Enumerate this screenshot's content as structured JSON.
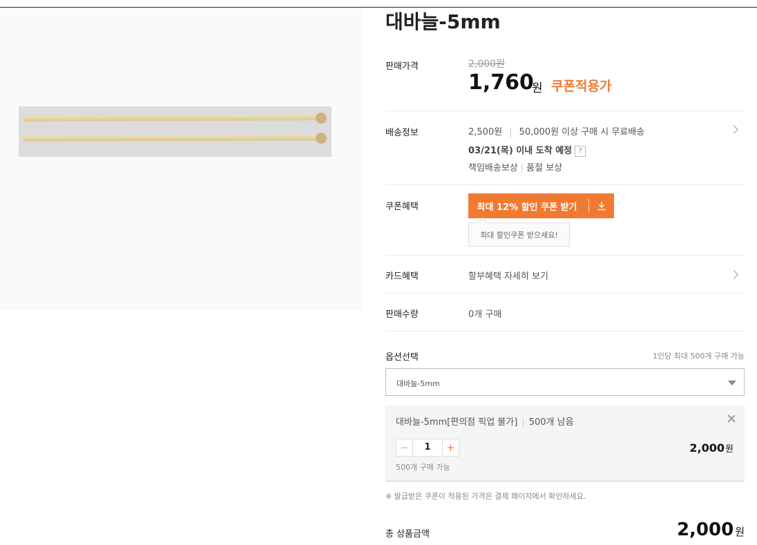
{
  "product": {
    "title": "대바늘-5mm"
  },
  "price": {
    "label": "판매가격",
    "original": "2,000원",
    "sale": "1,760",
    "sale_unit": "원",
    "coupon_applied": "쿠폰적용가"
  },
  "shipping": {
    "label": "배송정보",
    "fee": "2,500원",
    "free_condition": "50,000원 이상 구매 시 무료배송",
    "arrival": "03/21(목) 이내 도착 예정",
    "arrival_help_icon": "?",
    "guarantee_1": "책임배송보상",
    "guarantee_2": "품절 보상"
  },
  "coupon": {
    "label": "쿠폰혜택",
    "button_label": "최대 12% 할인 쿠폰 받기",
    "download_icon": "download-icon",
    "tooltip": "최대 할인쿠폰 받으세요!"
  },
  "card": {
    "label": "카드혜택",
    "text": "할부혜택 자세히 보기"
  },
  "sales": {
    "label": "판매수량",
    "text": "0개 구매"
  },
  "options": {
    "label": "옵션선택",
    "limit": "1인당 최대 500개 구매 가능",
    "selected": "대바늘-5mm",
    "item": {
      "name": "대바늘-5mm[편의점 픽업 불가]",
      "remaining": "500개 남음",
      "quantity": "1",
      "minus": "−",
      "plus": "+",
      "available": "500개 구매 가능",
      "price": "2,000",
      "price_unit": "원"
    }
  },
  "notice": "※ 발급받은 쿠폰이 적용된 가격은 결제 페이지에서 확인하세요.",
  "total": {
    "label": "총 상품금액",
    "value": "2,000",
    "unit": "원"
  },
  "colors": {
    "accent": "#f07a32",
    "text": "#222222",
    "muted": "#888888"
  }
}
